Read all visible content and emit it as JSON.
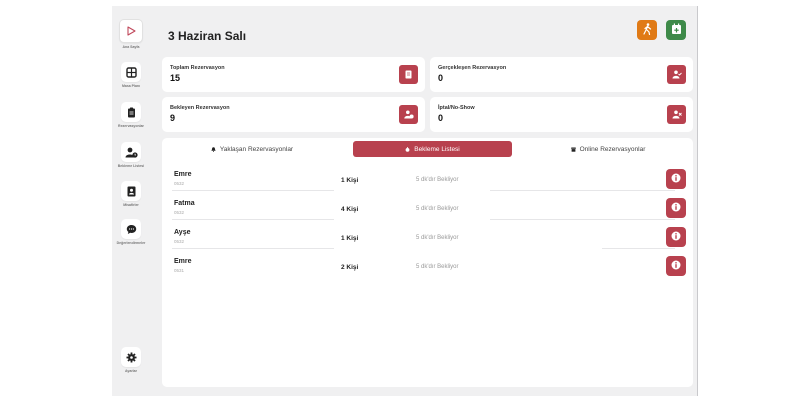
{
  "colors": {
    "accent": "#b8414e",
    "orange": "#e07a16",
    "green": "#3e8a49",
    "background": "#f0f0f1"
  },
  "sidebar": {
    "items": [
      {
        "label": "Ana Sayfa",
        "icon": "play-icon"
      },
      {
        "label": "Masa Planı",
        "icon": "grid-icon"
      },
      {
        "label": "Rezervasyonlar",
        "icon": "clipboard-icon"
      },
      {
        "label": "Bekleme Listesi",
        "icon": "user-clock-icon"
      },
      {
        "label": "Misafirler",
        "icon": "address-book-icon"
      },
      {
        "label": "Değerlendirmeler",
        "icon": "comment-icon"
      }
    ],
    "settings_label": "Ayarlar"
  },
  "header": {
    "title": "3 Haziran Salı"
  },
  "stats": [
    {
      "label": "Toplam Rezervasyon",
      "value": "15",
      "icon": "book-icon"
    },
    {
      "label": "Gerçekleşen Rezervasyon",
      "value": "0",
      "icon": "user-check-icon"
    },
    {
      "label": "Bekleyen Rezervasyon",
      "value": "9",
      "icon": "user-clock-icon"
    },
    {
      "label": "İptal/No-Show",
      "value": "0",
      "icon": "user-x-icon"
    }
  ],
  "tabs": [
    {
      "label": "Yaklaşan Rezervasyonlar",
      "icon": "bell-icon",
      "active": false
    },
    {
      "label": "Bekleme Listesi",
      "icon": "stopwatch-icon",
      "active": true
    },
    {
      "label": "Online Rezervasyonlar",
      "icon": "store-icon",
      "active": false
    }
  ],
  "waitlist": [
    {
      "name": "Emre",
      "phone": "0532",
      "people": "1 Kişi",
      "wait": "5 dk'dır Bekliyor"
    },
    {
      "name": "Fatma",
      "phone": "0532",
      "people": "4 Kişi",
      "wait": "5 dk'dır Bekliyor"
    },
    {
      "name": "Ayşe",
      "phone": "0532",
      "people": "1 Kişi",
      "wait": "5 dk'dır Bekliyor"
    },
    {
      "name": "Emre",
      "phone": "0531",
      "people": "2 Kişi",
      "wait": "5 dk'dır Bekliyor"
    }
  ]
}
